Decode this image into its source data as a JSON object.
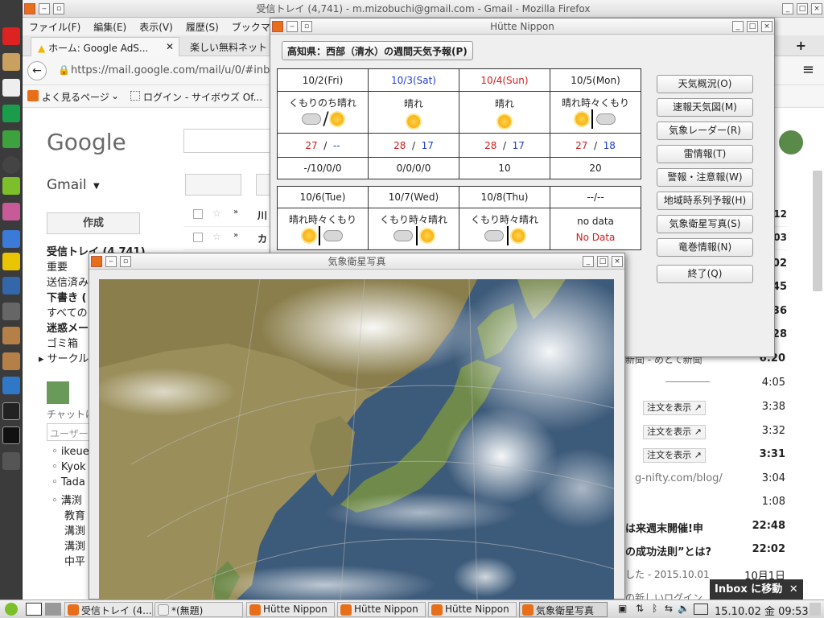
{
  "firefox": {
    "title": "受信トレイ (4,741) - m.mizobuchi@gmail.com - Gmail - Mozilla Firefox",
    "menu": [
      "ファイル(F)",
      "編集(E)",
      "表示(V)",
      "履歴(S)",
      "ブックマーク"
    ],
    "tabs": [
      "ホーム: Google AdS...",
      "楽しい無料ネット"
    ],
    "url": "https://mail.google.com/mail/u/0/#inb",
    "bookmarks": [
      "よく見るページ",
      "ログイン - サイボウズ Of..."
    ]
  },
  "gmail": {
    "logo": "Google",
    "label": "Gmail",
    "compose": "作成",
    "sidebar": [
      "受信トレイ (4,741)",
      "重要",
      "送信済み",
      "下書き (",
      "すべての",
      "迷惑メー",
      "ゴミ箱",
      "サークル"
    ],
    "chat_label": "チャットに",
    "user_placeholder": "ユーザー",
    "contacts": [
      "ikeue",
      "Kyok",
      "Tada",
      "溝渕",
      "教育",
      "溝渕",
      "溝渕",
      "中平"
    ],
    "rows_top": [
      {
        "from": "川",
        "time": "12"
      },
      {
        "from": "カ",
        "time": "03"
      }
    ],
    "row_times_right": [
      "02",
      "45",
      "36",
      "28"
    ],
    "rows": [
      {
        "text": "新聞 - めとて新聞",
        "time": "6:20"
      },
      {
        "text": "",
        "time": "4:05"
      },
      {
        "text": "注文を表示",
        "time": "3:38"
      },
      {
        "text": "注文を表示",
        "time": "3:32"
      },
      {
        "text": "注文を表示",
        "time": "3:31"
      },
      {
        "text": "g-nifty.com/blog/",
        "time": "3:04"
      },
      {
        "text": "",
        "time": "1:08"
      },
      {
        "text": "は来週末開催!申",
        "time": "22:48"
      },
      {
        "text": "の成功法則”とは?",
        "time": "22:02"
      },
      {
        "text": "した - 2015.10.01",
        "time": "10月1日"
      },
      {
        "text": "の新しいログイン",
        "time": ""
      }
    ],
    "inbox_toast": "Inbox に移動"
  },
  "weather": {
    "title": "Hütte Nippon",
    "heading": "高知県：西部（清水）の週間天気予報(P)",
    "week1": [
      {
        "date": "10/2(Fri)",
        "color": "#000000",
        "forecast": "くもりのち晴れ",
        "icons": "cloud/sun",
        "hi": "27",
        "lo": "--",
        "rain": "-/10/0/0"
      },
      {
        "date": "10/3(Sat)",
        "color": "#1e3fd0",
        "forecast": "晴れ",
        "icons": "sun",
        "hi": "28",
        "lo": "17",
        "rain": "0/0/0/0"
      },
      {
        "date": "10/4(Sun)",
        "color": "#d01e1e",
        "forecast": "晴れ",
        "icons": "sun",
        "hi": "28",
        "lo": "17",
        "rain": "10"
      },
      {
        "date": "10/5(Mon)",
        "color": "#000000",
        "forecast": "晴れ時々くもり",
        "icons": "sun|cloud",
        "hi": "27",
        "lo": "18",
        "rain": "20"
      }
    ],
    "week2": [
      {
        "date": "10/6(Tue)",
        "forecast": "晴れ時々くもり",
        "icons": "sun|cloud"
      },
      {
        "date": "10/7(Wed)",
        "forecast": "くもり時々晴れ",
        "icons": "cloud|sun"
      },
      {
        "date": "10/8(Thu)",
        "forecast": "くもり時々晴れ",
        "icons": "cloud|sun"
      },
      {
        "date": "--/--",
        "forecast": "no data",
        "nodata": "No Data"
      }
    ],
    "buttons": [
      "天気概況(O)",
      "速報天気図(M)",
      "気象レーダー(R)",
      "雷情報(T)",
      "警報・注意報(W)",
      "地域時系列予報(H)",
      "気象衛星写真(S)",
      "竜巻情報(N)",
      "終了(Q)"
    ]
  },
  "satellite": {
    "title": "気象衛星写真"
  },
  "taskbar": {
    "tasks": [
      "受信トレイ (4...",
      "*(無題)",
      "Hütte Nippon",
      "Hütte Nippon",
      "Hütte Nippon",
      "気象衛星写真"
    ],
    "clock": "15.10.02 金 09:53"
  },
  "colors": {
    "hi": "#d01e1e",
    "lo": "#1e3fd0",
    "nodata": "#d01e1e"
  }
}
